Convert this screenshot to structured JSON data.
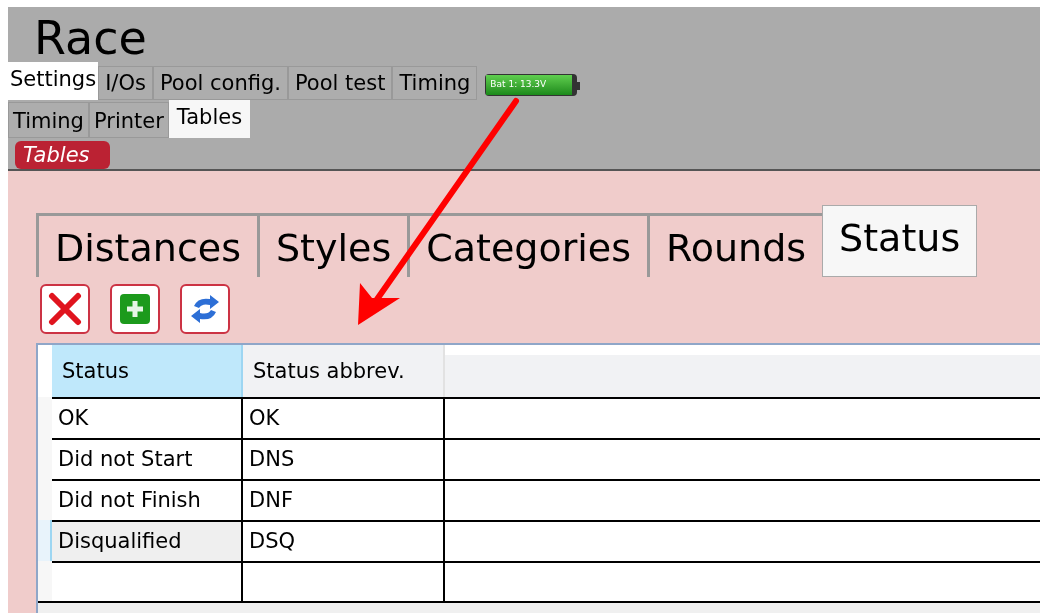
{
  "window": {
    "title": "Race"
  },
  "main_tabs": [
    {
      "label": "Settings",
      "selected": true
    },
    {
      "label": "I/Os",
      "selected": false
    },
    {
      "label": "Pool config.",
      "selected": false
    },
    {
      "label": "Pool test",
      "selected": false
    },
    {
      "label": "Timing",
      "selected": false
    }
  ],
  "battery": {
    "label": "Bat 1: 13.3V",
    "level": 0.95
  },
  "sub_tabs": [
    {
      "label": "Timing",
      "selected": false
    },
    {
      "label": "Printer",
      "selected": false
    },
    {
      "label": "Tables",
      "selected": true
    }
  ],
  "section_badge": "Tables",
  "table_tabs": [
    {
      "label": "Distances",
      "selected": false
    },
    {
      "label": "Styles",
      "selected": false
    },
    {
      "label": "Categories",
      "selected": false
    },
    {
      "label": "Rounds",
      "selected": false
    },
    {
      "label": "Status",
      "selected": true
    }
  ],
  "toolbar": [
    {
      "kind": "delete"
    },
    {
      "kind": "add"
    },
    {
      "kind": "refresh"
    }
  ],
  "table": {
    "columns": [
      {
        "label": "Status",
        "selected": true
      },
      {
        "label": "Status abbrev.",
        "selected": false
      }
    ],
    "rows": [
      {
        "cells": [
          "OK",
          "OK"
        ],
        "selected": false
      },
      {
        "cells": [
          "Did not Start",
          "DNS"
        ],
        "selected": false
      },
      {
        "cells": [
          "Did not Finish",
          "DNF"
        ],
        "selected": false
      },
      {
        "cells": [
          "Disqualified",
          "DSQ"
        ],
        "selected": true
      }
    ]
  }
}
